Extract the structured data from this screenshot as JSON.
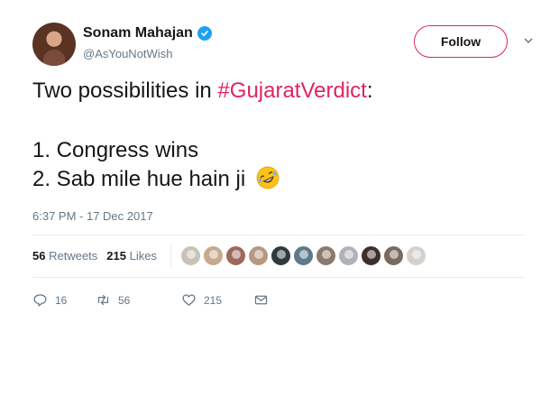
{
  "user": {
    "display_name": "Sonam Mahajan",
    "handle": "@AsYouNotWish",
    "verified": true
  },
  "follow_label": "Follow",
  "tweet": {
    "intro": "Two possibilities in ",
    "hashtag": "#GujaratVerdict",
    "intro_end": ":",
    "line1": "1. Congress wins",
    "line2": "2. Sab mile hue hain ji",
    "emoji": "rolling-on-floor-laughing-emoji"
  },
  "timestamp": "6:37 PM - 17 Dec 2017",
  "stats": {
    "retweets_count": "56",
    "retweets_label": "Retweets",
    "likes_count": "215",
    "likes_label": "Likes"
  },
  "liker_avatars": [
    "#c9c2b8",
    "#c7a98f",
    "#9c6a5c",
    "#b89880",
    "#2f3a3f",
    "#5d7a8c",
    "#8c7a6a",
    "#b0b4b8",
    "#3f2f2a",
    "#7a6a5e",
    "#d4d0cc"
  ],
  "actions": {
    "reply_count": "16",
    "retweet_count": "56",
    "like_count": "215"
  },
  "colors": {
    "accent": "#e0245e",
    "verified": "#1da1f2",
    "muted": "#657786"
  }
}
